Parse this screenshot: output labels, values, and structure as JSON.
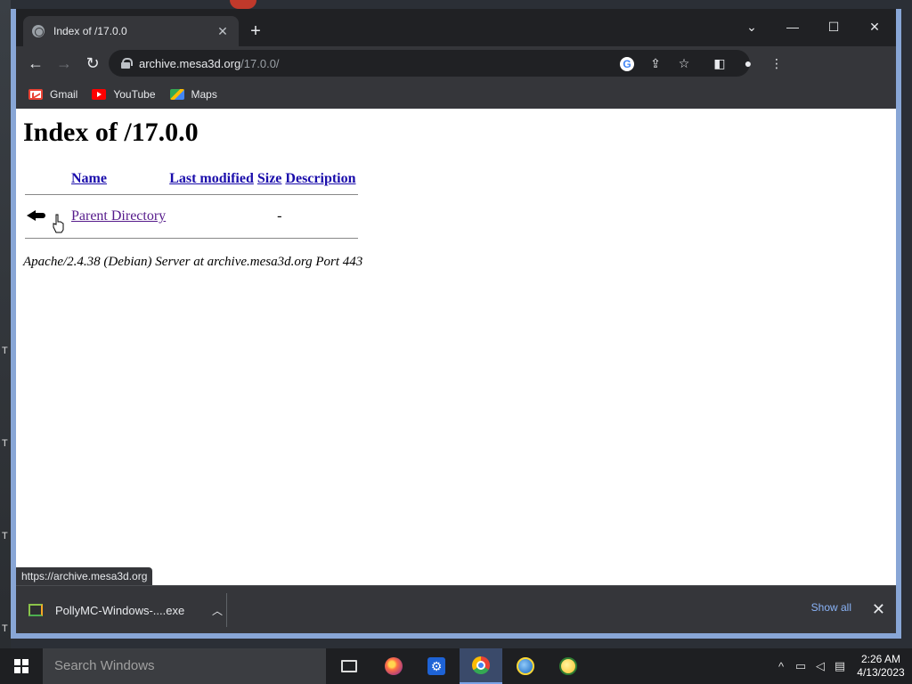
{
  "browser": {
    "tab": {
      "title": "Index of /17.0.0",
      "close_glyph": "✕"
    },
    "new_tab_glyph": "+",
    "window_controls": {
      "tab_search": "⌄",
      "minimize": "—",
      "maximize": "☐",
      "close": "✕"
    },
    "nav": {
      "back": "←",
      "forward": "→",
      "reload": "↻"
    },
    "omnibox": {
      "host": "archive.mesa3d.org",
      "path": "/17.0.0/"
    },
    "omnibox_icons": [
      "google-lens-icon",
      "share-icon",
      "bookmark-star-icon"
    ],
    "toolbar_icons": [
      "side-panel-icon",
      "profile-icon",
      "menu-icon"
    ],
    "bookmarks": [
      {
        "label": "Gmail",
        "icon": "gmail-icon"
      },
      {
        "label": "YouTube",
        "icon": "youtube-icon"
      },
      {
        "label": "Maps",
        "icon": "maps-icon"
      }
    ],
    "status_url": "https://archive.mesa3d.org"
  },
  "page": {
    "heading": "Index of /17.0.0",
    "columns": [
      "Name",
      "Last modified",
      "Size",
      "Description"
    ],
    "rows": [
      {
        "name": "Parent Directory",
        "modified": "",
        "size": "-",
        "description": ""
      }
    ],
    "address": "Apache/2.4.38 (Debian) Server at archive.mesa3d.org Port 443"
  },
  "downloads": {
    "item": {
      "name": "PollyMC-Windows-....exe"
    },
    "show_all": "Show all",
    "close_glyph": "✕"
  },
  "taskbar": {
    "search_placeholder": "Search Windows",
    "apps": [
      "task-view",
      "firefox",
      "settings",
      "chrome",
      "browser-globe",
      "network-globe"
    ],
    "active_app": "chrome",
    "clock": {
      "time": "2:26 AM",
      "date": "4/13/2023"
    }
  },
  "colors": {
    "accent": "#88a6d6",
    "link": "#1a0dab",
    "visited": "#551a8b",
    "shelf_link": "#8ab4f8"
  }
}
